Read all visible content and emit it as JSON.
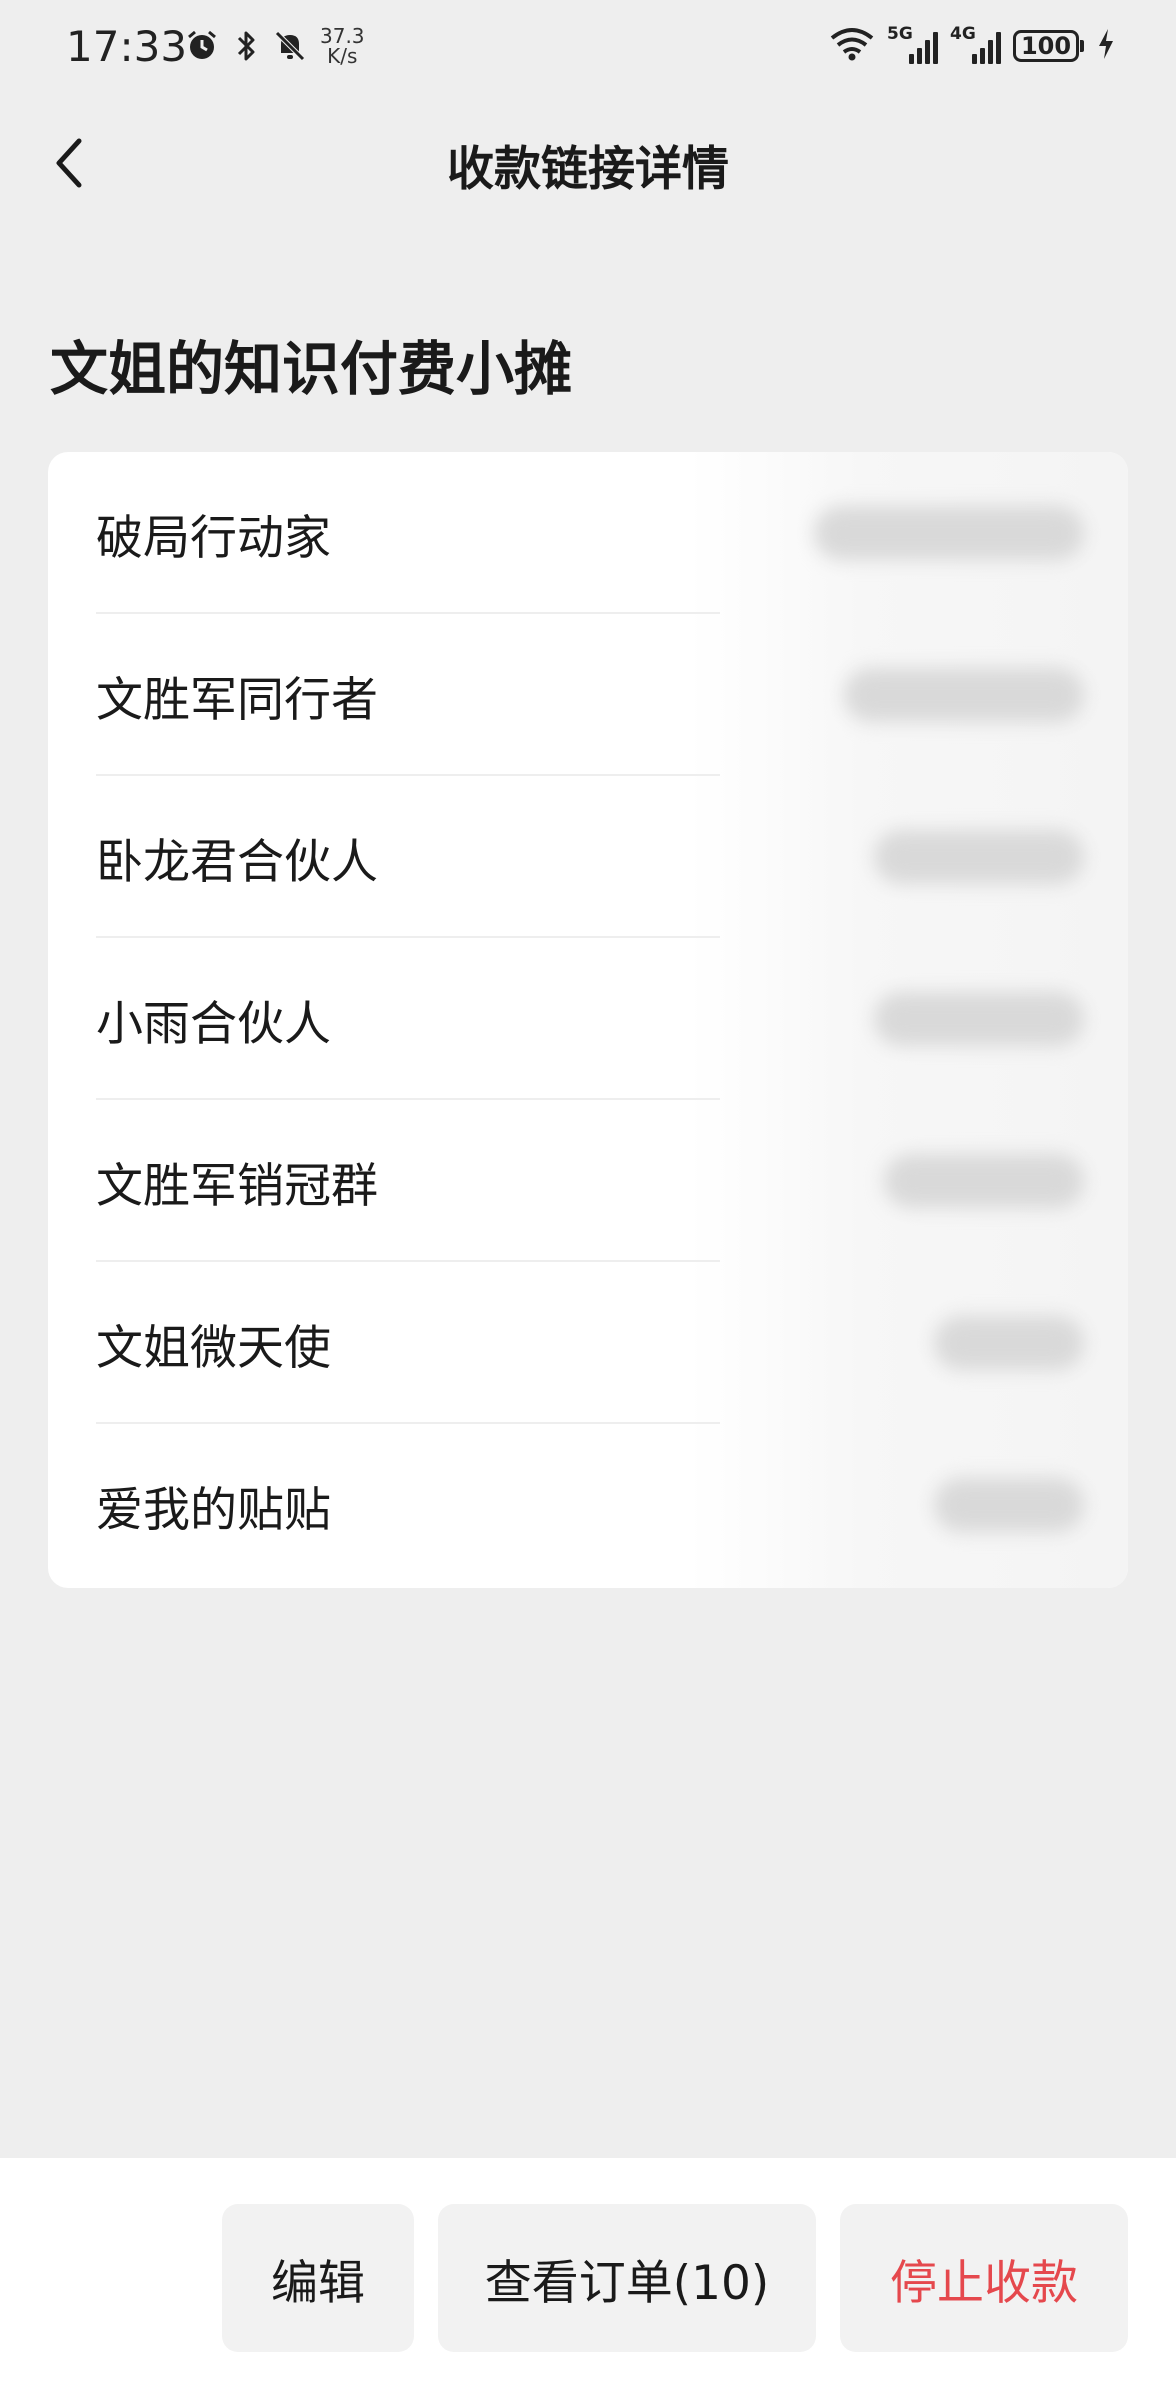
{
  "status_bar": {
    "time": "17:33",
    "net_speed_value": "37.3",
    "net_speed_unit": "K/s",
    "signal1_tag": "5G",
    "signal2_tag": "4G",
    "battery": "100"
  },
  "header": {
    "title": "收款链接详情"
  },
  "section": {
    "title": "文姐的知识付费小摊"
  },
  "list": {
    "items": [
      {
        "label": "破局行动家"
      },
      {
        "label": "文胜军同行者"
      },
      {
        "label": "卧龙君合伙人"
      },
      {
        "label": "小雨合伙人"
      },
      {
        "label": "文胜军销冠群"
      },
      {
        "label": "文姐微天使"
      },
      {
        "label": "爱我的贴贴"
      }
    ]
  },
  "actions": {
    "edit": "编辑",
    "orders": "查看订单(10)",
    "stop": "停止收款"
  },
  "colors": {
    "background": "#eeeeee",
    "card": "#ffffff",
    "danger": "#e5484d"
  }
}
